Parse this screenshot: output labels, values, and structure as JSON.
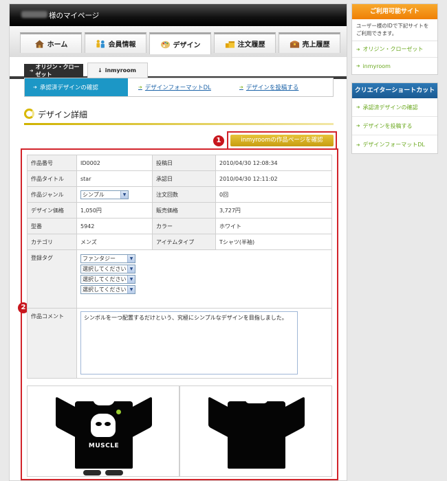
{
  "header": {
    "title": "様のマイページ"
  },
  "nav": {
    "tabs": [
      {
        "label": "ホーム",
        "icon": "home-icon"
      },
      {
        "label": "会員情報",
        "icon": "member-icon"
      },
      {
        "label": "デザイン",
        "icon": "palette-icon"
      },
      {
        "label": "注文履歴",
        "icon": "coins-icon"
      },
      {
        "label": "売上履歴",
        "icon": "chest-icon"
      }
    ]
  },
  "site_tabs": [
    {
      "label": "オリジン・クローゼット",
      "prefix": "➔"
    },
    {
      "label": "inmyroom",
      "prefix": "↓"
    }
  ],
  "subnav": [
    {
      "label": "承認済デザインの確認"
    },
    {
      "label": "デザインフォーマットDL"
    },
    {
      "label": "デザインを投稿する"
    }
  ],
  "section_title": "デザイン詳細",
  "cta": {
    "label": "inmyroomの作品ページを確認",
    "badge": "1"
  },
  "detail_badge": "2",
  "details": {
    "item_no_label": "作品番号",
    "item_no": "ID0002",
    "post_date_label": "投稿日",
    "post_date": "2010/04/30 12:08:34",
    "item_title_label": "作品タイトル",
    "item_title": "star",
    "approve_date_label": "承認日",
    "approve_date": "2010/04/30 12:11:02",
    "genre_label": "作品ジャンル",
    "genre": "シンプル",
    "order_count_label": "注文回数",
    "order_count": "0回",
    "design_price_label": "デザイン価格",
    "design_price": "1,050円",
    "sale_price_label": "販売価格",
    "sale_price": "3,727円",
    "model_label": "型番",
    "model": "5942",
    "color_label": "カラー",
    "color": "ホワイト",
    "category_label": "カテゴリ",
    "category": "メンズ",
    "item_type_label": "アイテムタイプ",
    "item_type": "Tシャツ(半袖)",
    "tags_label": "登録タグ",
    "tags": [
      "ファンタジー",
      "選択してください",
      "選択してください",
      "選択してください"
    ],
    "comment_label": "作品コメント",
    "comment": "シンボルを一つ配置するだけという、究極にシンプルなデザインを目指しました。"
  },
  "shirt_print": "MUSCLE",
  "sidebar": {
    "available": {
      "title": "ご利用可能サイト",
      "desc": "ユーザー様のIDで下記サイトをご利用できます。",
      "items": [
        "オリジン・クローゼット",
        "inmyroom"
      ]
    },
    "shortcuts": {
      "title": "クリエイターショートカット",
      "items": [
        "承認済デザインの確認",
        "デザインを投稿する",
        "デザインフォーマットDL"
      ]
    }
  },
  "colors": {
    "accent_blue": "#1c97c6",
    "accent_orange": "#ef7f05",
    "highlight_red": "#d2232a",
    "gold": "#d0b300"
  }
}
